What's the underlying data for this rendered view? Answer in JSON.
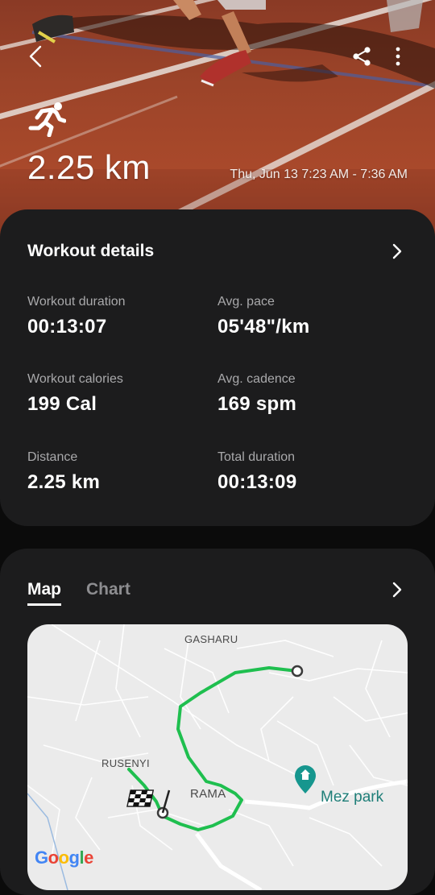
{
  "header": {
    "distance": "2.25 km",
    "date_range": "Thu, Jun 13 7:23 AM - 7:36 AM",
    "back_icon": "chevron-left-icon",
    "share_icon": "share-icon",
    "more_icon": "more-vertical-icon",
    "activity_icon": "running-icon"
  },
  "details": {
    "title": "Workout details",
    "stats": [
      {
        "label": "Workout duration",
        "value": "00:13:07"
      },
      {
        "label": "Avg. pace",
        "value": "05'48\"/km"
      },
      {
        "label": "Workout calories",
        "value": "199 Cal"
      },
      {
        "label": "Avg. cadence",
        "value": "169 spm"
      },
      {
        "label": "Distance",
        "value": "2.25 km"
      },
      {
        "label": "Total duration",
        "value": "00:13:09"
      }
    ]
  },
  "map_section": {
    "tabs": [
      {
        "label": "Map",
        "selected": true
      },
      {
        "label": "Chart",
        "selected": false
      }
    ],
    "places": {
      "north": "GASHARU",
      "west": "RUSENYI",
      "center": "RAMA",
      "poi": "Mez park"
    },
    "attribution": "Google",
    "route_color": "#1fbf4f"
  },
  "colors": {
    "background": "#0b0b0b",
    "card": "#1c1c1d",
    "muted_text": "#a9a9ab",
    "track": "#a9492b"
  }
}
